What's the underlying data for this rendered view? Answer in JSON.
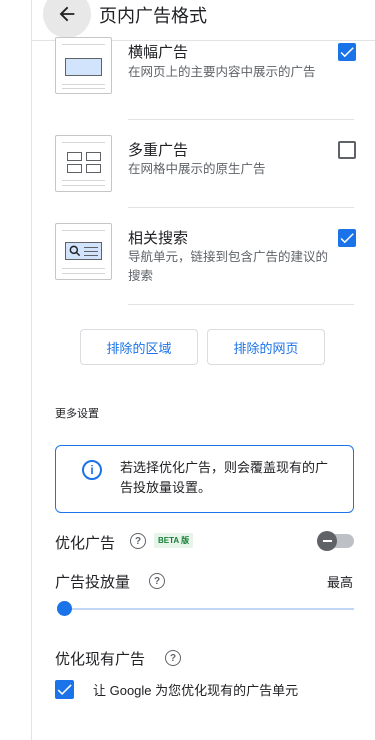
{
  "header": {
    "title": "页内广告格式",
    "back_icon": "arrow-left-icon"
  },
  "formats": [
    {
      "title": "横幅广告",
      "description": "在网页上的主要内容中展示的广告",
      "checked": true,
      "icon": "banner-ad-icon"
    },
    {
      "title": "多重广告",
      "description": "在网格中展示的原生广告",
      "checked": false,
      "icon": "multiplex-ad-icon"
    },
    {
      "title": "相关搜索",
      "description": "导航单元，链接到包含广告的建议的搜索",
      "checked": true,
      "icon": "related-search-icon"
    }
  ],
  "buttons": {
    "exclude_areas": "排除的区域",
    "exclude_pages": "排除的网页"
  },
  "more_settings": {
    "label": "更多设置",
    "info_text": "若选择优化广告，则会覆盖现有的广告投放量设置。",
    "optimize_ads_label": "优化广告",
    "beta_label": "BETA 版",
    "optimize_ads_enabled": false,
    "ad_load_label": "广告投放量",
    "ad_load_max_label": "最高",
    "ad_load_value": 0,
    "optimize_existing_label": "优化现有广告",
    "optimize_existing_checkbox_label": "让 Google 为您优化现有的广告单元",
    "optimize_existing_checked": true
  },
  "colors": {
    "accent": "#1a73e8",
    "beta_bg": "#e6f4ea",
    "beta_text": "#188038"
  }
}
